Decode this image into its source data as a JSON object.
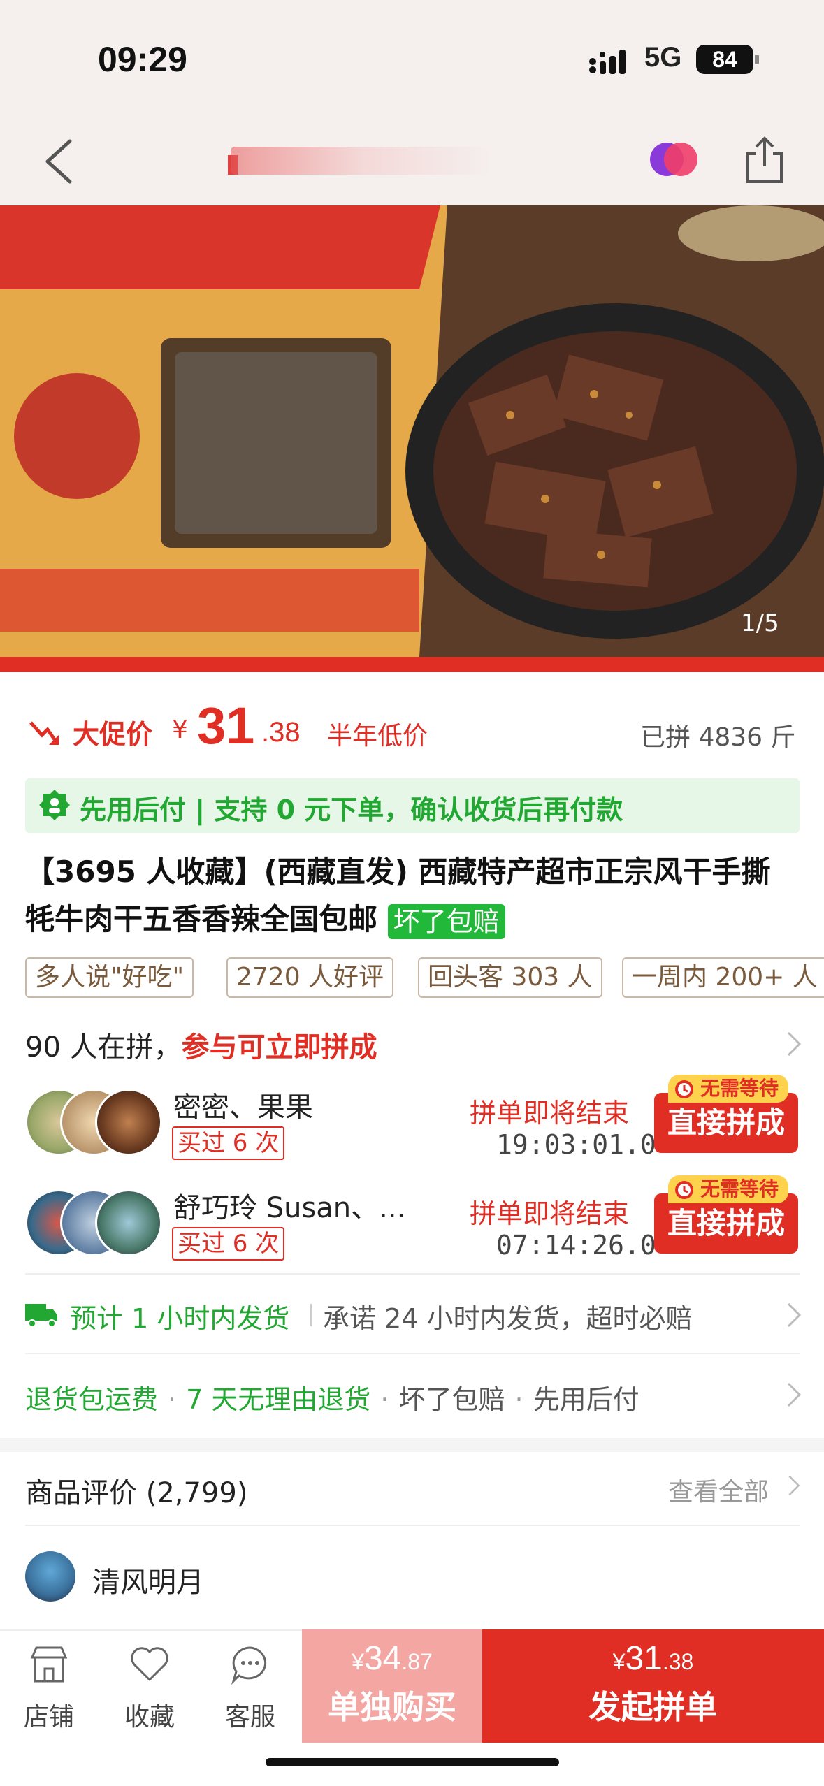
{
  "status": {
    "time": "09:29",
    "network": "5G",
    "battery": "84"
  },
  "nav": {
    "back": "back",
    "share": "share"
  },
  "hero": {
    "counter": "1/5"
  },
  "price": {
    "promo_label": "大促价",
    "yen": "¥",
    "integer": "31",
    "decimal": ".38",
    "low_tag": "半年低价",
    "sold": "已拼 4836 斤"
  },
  "pay_banner": {
    "text": "先用后付 | 支持 0 元下单，确认收货后再付款"
  },
  "title": {
    "text": "【3695 人收藏】(西藏直发) 西藏特产超市正宗风干手撕牦牛肉干五香香辣全国包邮",
    "badge": "坏了包赔"
  },
  "tags": [
    "多人说\"好吃\"",
    "2720 人好评",
    "回头客 303 人",
    "一周内 200+ 人"
  ],
  "group": {
    "head_count": "90 人在拼，",
    "head_action": "参与可立即拼成",
    "entries": [
      {
        "names": "密密、果果",
        "bought": "买过 6 次",
        "ending": "拼单即将结束",
        "timer": "19:03:01.0",
        "nowait": "无需等待",
        "button": "直接拼成"
      },
      {
        "names": "舒巧玲 Susan、...",
        "bought": "买过 6 次",
        "ending": "拼单即将结束",
        "timer": "07:14:26.0",
        "nowait": "无需等待",
        "button": "直接拼成"
      }
    ]
  },
  "shipping": {
    "estimate": "预计 1 小时内发货",
    "promise": "承诺 24 小时内发货，超时必赔"
  },
  "services": {
    "green": [
      "退货包运费",
      "7 天无理由退货"
    ],
    "gray": [
      "坏了包赔",
      "先用后付"
    ],
    "sep": "·"
  },
  "reviews": {
    "title": "商品评价 (2,799)",
    "see_all": "查看全部",
    "user": "清风明月"
  },
  "bottom": {
    "store": "店铺",
    "fav": "收藏",
    "service": "客服",
    "solo_yen": "¥",
    "solo_int": "34",
    "solo_dec": ".87",
    "solo_label": "单独购买",
    "group_yen": "¥",
    "group_int": "31",
    "group_dec": ".38",
    "group_label": "发起拼单"
  },
  "colors": {
    "accent": "#e02e24",
    "green": "#22a832",
    "tag_border": "#c9b8a6"
  }
}
